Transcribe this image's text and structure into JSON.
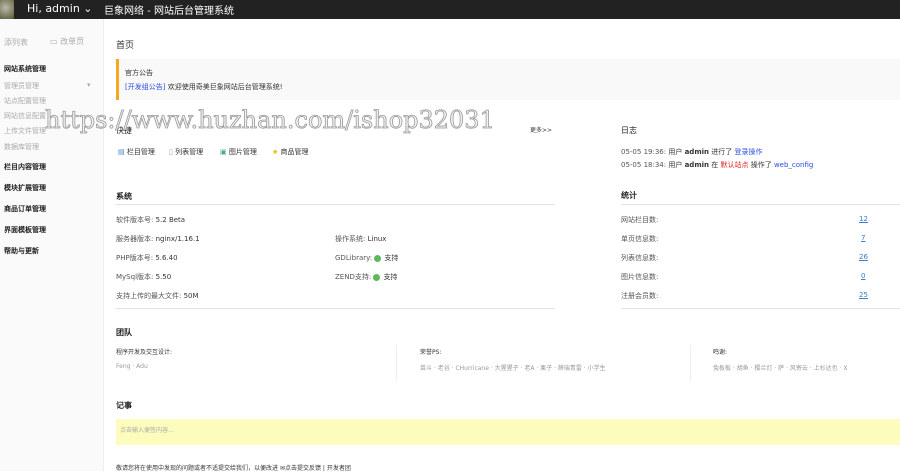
{
  "header": {
    "greeting": "Hi, admin",
    "title": "巨象网络 - 网站后台管理系统"
  },
  "sidebar": {
    "add_list": "添列表",
    "change_page": "改单页",
    "groups": [
      {
        "label": "网站系统管理",
        "items": [
          "管理员管理",
          "站点配置管理",
          "网站信息配置",
          "上传文件管理",
          "数据库管理"
        ]
      },
      {
        "label": "栏目内容管理"
      },
      {
        "label": "模块扩展管理"
      },
      {
        "label": "商品订单管理"
      },
      {
        "label": "界面模板管理"
      },
      {
        "label": "帮助与更新"
      }
    ]
  },
  "main": {
    "page_title": "首页",
    "notice": {
      "title": "官方公告",
      "tag": "[开发组公告]",
      "text": "欢迎使用奇美巨象网站后台管理系统!"
    },
    "shortcuts": {
      "title": "快捷",
      "more": "更多>>",
      "items": [
        "栏目管理",
        "列表管理",
        "图片管理",
        "商品管理"
      ]
    },
    "log": {
      "title": "日志",
      "entries": [
        {
          "time": "05-05 19:36:",
          "pre": "用户",
          "user": "admin",
          "mid": "进行了",
          "action": "登录操作"
        },
        {
          "time": "05-05 18:34:",
          "pre": "用户",
          "user": "admin",
          "mid": "在",
          "site": "默认站点",
          "mid2": "操作了",
          "action": "web_config"
        }
      ]
    },
    "system": {
      "title": "系统",
      "rows": [
        {
          "label": "软件版本号:",
          "value": "5.2 Beta"
        },
        {
          "label": "服务器版本:",
          "value": "nginx/1.16.1"
        },
        {
          "label": "PHP版本号:",
          "value": "5.6.40"
        },
        {
          "label": "MySql版本:",
          "value": "5.50"
        },
        {
          "label": "支持上传的最大文件:",
          "value": "50M"
        }
      ],
      "right": [
        {
          "label": "操作系统:",
          "value": "Linux"
        },
        {
          "label": "GDLibrary:",
          "value": "支持"
        },
        {
          "label": "ZEND支持:",
          "value": "支持"
        }
      ]
    },
    "stats": {
      "title": "统计",
      "rows": [
        {
          "label": "网站栏目数:",
          "value": "12"
        },
        {
          "label": "单页信息数:",
          "value": "7"
        },
        {
          "label": "列表信息数:",
          "value": "26"
        },
        {
          "label": "图片信息数:",
          "value": "0"
        },
        {
          "label": "注册会员数:",
          "value": "25"
        }
      ]
    },
    "team": {
      "title": "团队",
      "cols": [
        {
          "label": "程序开发及交互设计:",
          "names": "Feng · Adu"
        },
        {
          "label": "荣誉PS:",
          "names": "苗斗 · 老谷 · CHurricane · 大猩猩子 · 老A · 栗子 · 薛瑞青雷 · 小学生"
        },
        {
          "label": "鸣谢:",
          "names": "兔板板 · 胡鱼 · 樱兰灯 · 萨 · 风寄云 · 上杉达也 · X"
        }
      ]
    },
    "notes": {
      "title": "记事",
      "placeholder": "点击输入便签内容..."
    },
    "footer": {
      "text": "敬请您将在使用中发现的问题或者不适提交给我们，以便改进",
      "feedback": "点击提交反馈",
      "sep": "|",
      "dev": "开发者团"
    }
  },
  "watermark": "https://www.huzhan.com/ishop32031"
}
